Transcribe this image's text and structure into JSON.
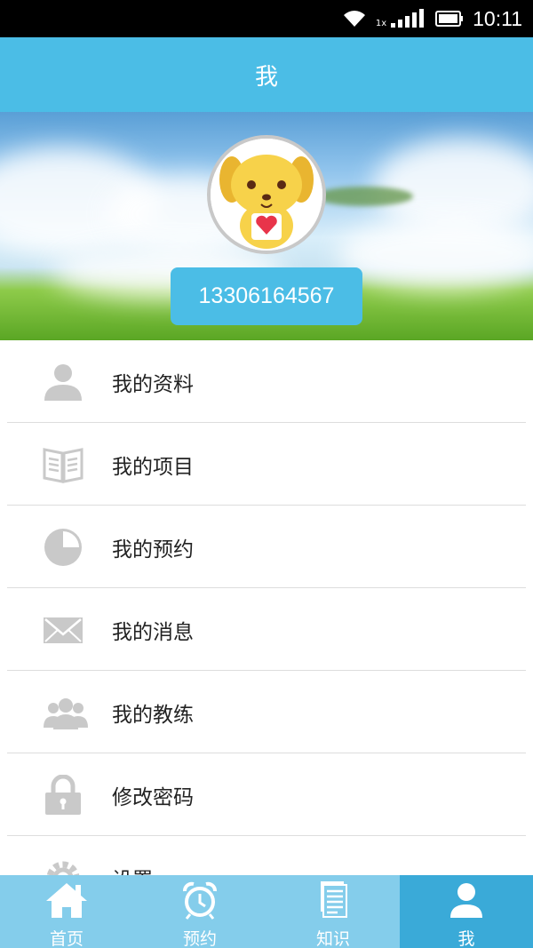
{
  "status_bar": {
    "time": "10:11",
    "network_label": "1x"
  },
  "header": {
    "title": "我"
  },
  "profile": {
    "phone": "13306164567"
  },
  "menu": {
    "items": [
      {
        "label": "我的资料",
        "icon": "person-icon"
      },
      {
        "label": "我的项目",
        "icon": "book-icon"
      },
      {
        "label": "我的预约",
        "icon": "pie-chart-icon"
      },
      {
        "label": "我的消息",
        "icon": "envelope-icon"
      },
      {
        "label": "我的教练",
        "icon": "group-icon"
      },
      {
        "label": "修改密码",
        "icon": "lock-icon"
      },
      {
        "label": "设置",
        "icon": "gear-icon"
      }
    ]
  },
  "tabbar": {
    "tabs": [
      {
        "label": "首页",
        "icon": "home-icon"
      },
      {
        "label": "预约",
        "icon": "alarm-clock-icon"
      },
      {
        "label": "知识",
        "icon": "document-icon"
      },
      {
        "label": "我",
        "icon": "user-icon",
        "active": true
      }
    ]
  },
  "colors": {
    "primary": "#4bbde6",
    "tab_bg": "#84cdeb",
    "tab_active": "#3aaad8",
    "icon_gray": "#c9c9c9"
  }
}
